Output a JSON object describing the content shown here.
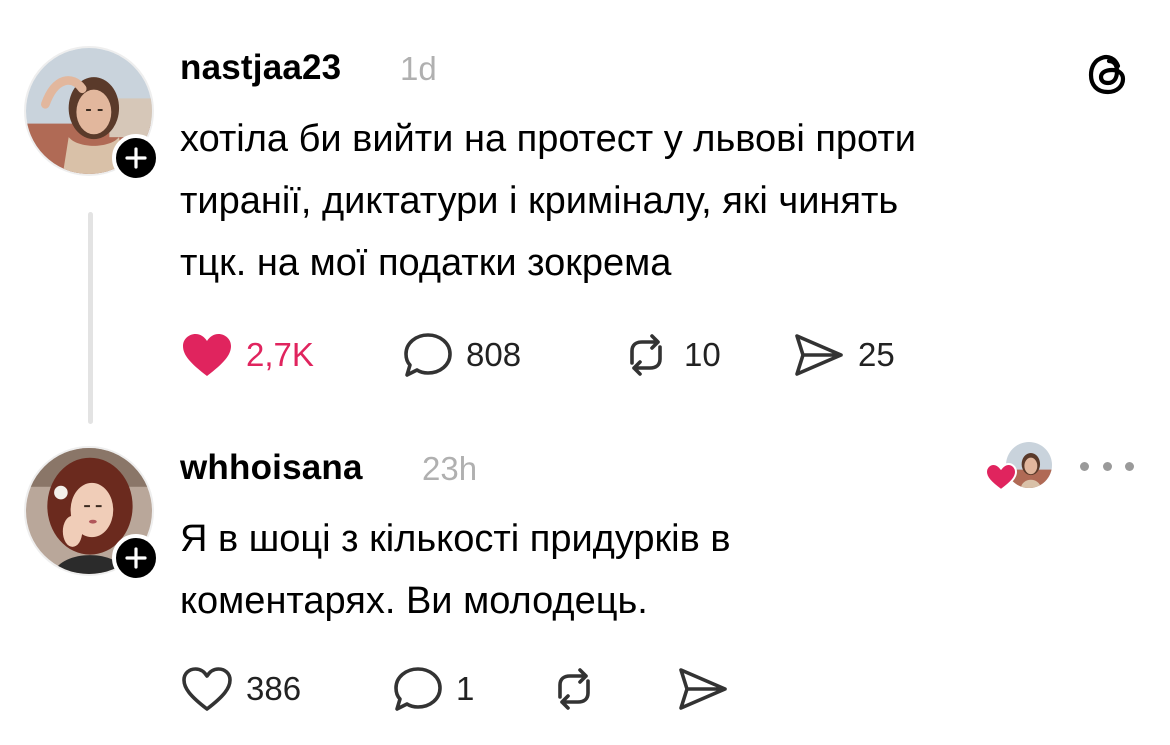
{
  "app": "Threads",
  "posts": [
    {
      "username": "nastjaa23",
      "time": "1d",
      "lines": [
        "хотіла би вийти на протест у львові проти",
        "тиранії, диктатури і криміналу, які чинять",
        "тцк. на мої податки зокрема"
      ],
      "likes": "2,7K",
      "liked": true,
      "replies": "808",
      "reposts": "10",
      "shares": "25"
    },
    {
      "username": "whhoisana",
      "time": "23h",
      "lines": [
        "Я в шоці з кількості придурків в",
        "коментарях. Ви молодець."
      ],
      "likes": "386",
      "liked": false,
      "replies": "1",
      "reposts": "",
      "shares": ""
    }
  ],
  "icons": {
    "app_logo": "threads-logo-icon",
    "like": "heart-icon",
    "reply": "speech-bubble-icon",
    "repost": "repost-arrows-icon",
    "share": "paper-plane-icon",
    "follow": "plus-icon",
    "more": "ellipsis-icon"
  },
  "colors": {
    "like_active": "#e0245e",
    "timestamp": "#b0b0b0",
    "thread_line": "#e3e3e3",
    "badge": "#000000"
  }
}
